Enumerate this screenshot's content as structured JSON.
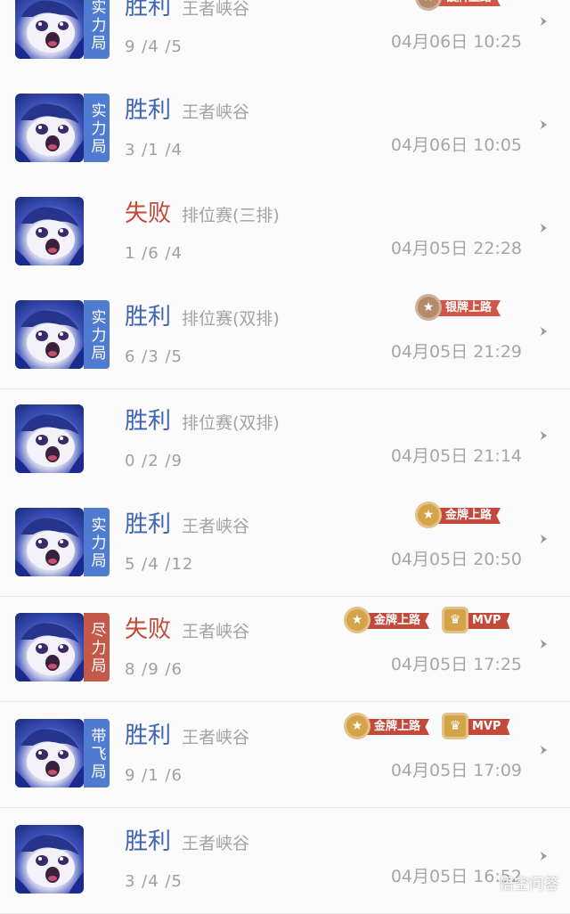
{
  "colors": {
    "win": "#3d63b3",
    "loss": "#c04a3a",
    "tag_blue": "#4f7bd0",
    "tag_red": "#c4594a",
    "silver_ribbon": "#d05545",
    "gold_ribbon": "#c3493a",
    "medal_silver": "#b48a6a",
    "medal_gold": "#d4a34a"
  },
  "matches": [
    {
      "result": "胜利",
      "result_type": "win",
      "mode": "王者峡谷",
      "kda": "9 /4 /5",
      "time": "04月06日 10:25",
      "tag": "实力局",
      "tag_color": "blue",
      "badges": [
        {
          "label": "银牌上路",
          "kind": "silver"
        }
      ]
    },
    {
      "result": "胜利",
      "result_type": "win",
      "mode": "王者峡谷",
      "kda": "3 /1 /4",
      "time": "04月06日 10:05",
      "tag": "实力局",
      "tag_color": "blue",
      "badges": []
    },
    {
      "result": "失败",
      "result_type": "loss",
      "mode": "排位赛(三排)",
      "kda": "1 /6 /4",
      "time": "04月05日 22:28",
      "tag": "",
      "tag_color": "",
      "badges": []
    },
    {
      "result": "胜利",
      "result_type": "win",
      "mode": "排位赛(双排)",
      "kda": "6 /3 /5",
      "time": "04月05日 21:29",
      "tag": "实力局",
      "tag_color": "blue",
      "badges": [
        {
          "label": "银牌上路",
          "kind": "silver"
        }
      ]
    },
    {
      "result": "胜利",
      "result_type": "win",
      "mode": "排位赛(双排)",
      "kda": "0 /2 /9",
      "time": "04月05日 21:14",
      "tag": "",
      "tag_color": "",
      "badges": []
    },
    {
      "result": "胜利",
      "result_type": "win",
      "mode": "王者峡谷",
      "kda": "5 /4 /12",
      "time": "04月05日 20:50",
      "tag": "实力局",
      "tag_color": "blue",
      "badges": [
        {
          "label": "金牌上路",
          "kind": "gold"
        }
      ]
    },
    {
      "result": "失败",
      "result_type": "loss",
      "mode": "王者峡谷",
      "kda": "8 /9 /6",
      "time": "04月05日 17:25",
      "tag": "尽力局",
      "tag_color": "red",
      "badges": [
        {
          "label": "金牌上路",
          "kind": "gold"
        },
        {
          "label": "MVP",
          "kind": "mvp"
        }
      ]
    },
    {
      "result": "胜利",
      "result_type": "win",
      "mode": "王者峡谷",
      "kda": "9 /1 /6",
      "time": "04月05日 17:09",
      "tag": "带飞局",
      "tag_color": "blue",
      "badges": [
        {
          "label": "金牌上路",
          "kind": "gold"
        },
        {
          "label": "MVP",
          "kind": "mvp"
        }
      ]
    },
    {
      "result": "胜利",
      "result_type": "win",
      "mode": "王者峡谷",
      "kda": "3 /4 /5",
      "time": "04月05日 16:52",
      "tag": "",
      "tag_color": "",
      "badges": []
    }
  ],
  "icons": {
    "row_arrow": "chevron-right-icon",
    "medal": "star-medal-icon",
    "trophy": "trophy-icon"
  },
  "watermark": "悟空问答"
}
